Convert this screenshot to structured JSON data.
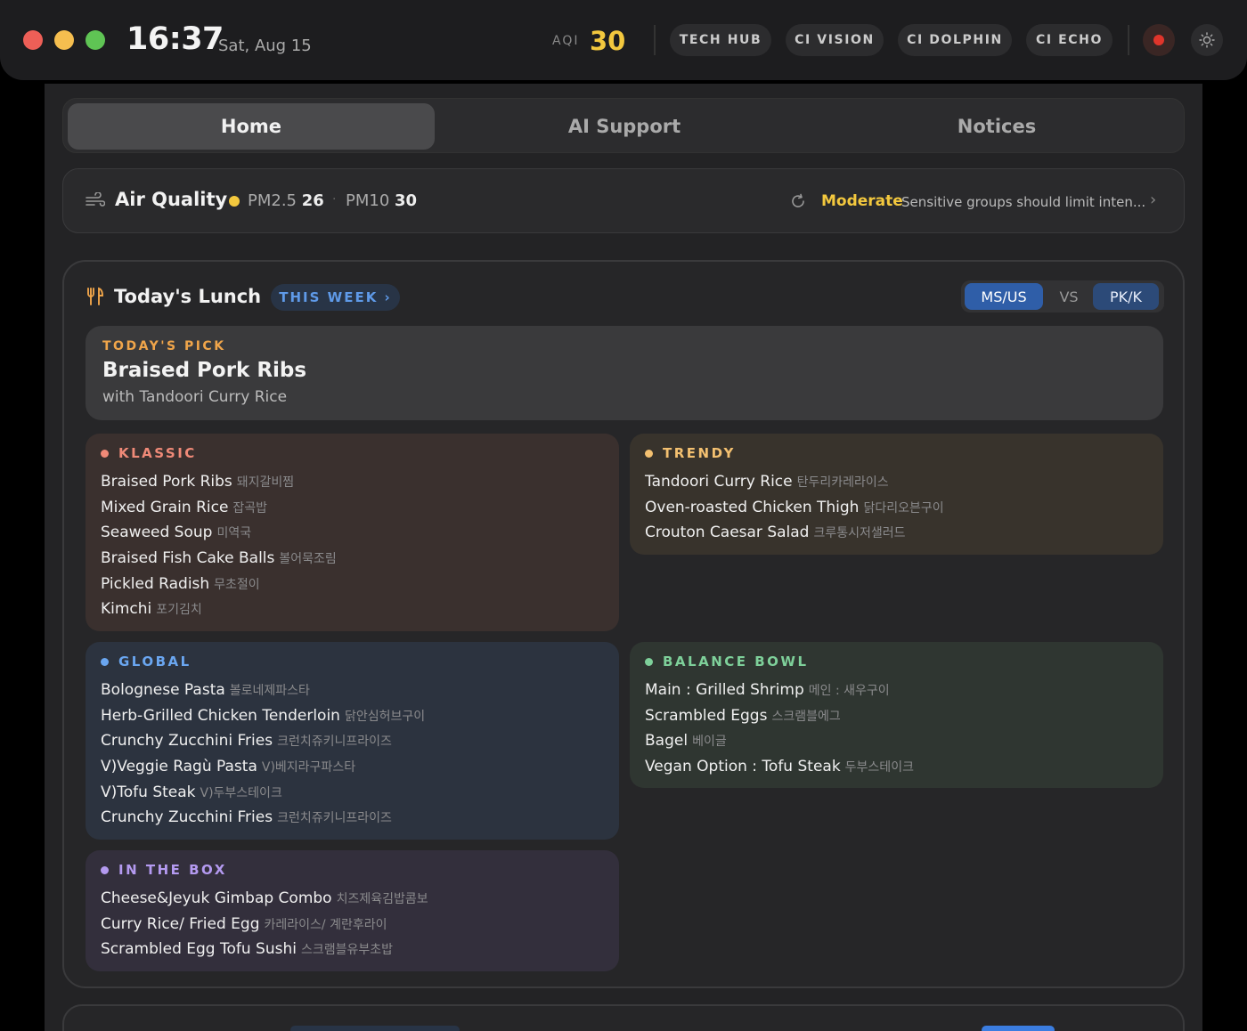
{
  "topbar": {
    "time": "16:37",
    "date": "Sat, Aug 15",
    "aqi_label": "AQI",
    "aqi_value": "30",
    "nav": [
      "TECH HUB",
      "CI VISION",
      "CI DOLPHIN",
      "CI ECHO"
    ]
  },
  "tabs": [
    "Home",
    "AI Support",
    "Notices"
  ],
  "air": {
    "title": "Air Quality",
    "pm25_label": "PM2.5",
    "pm25_value": "26",
    "pm10_label": "PM10",
    "pm10_value": "30",
    "status": "Moderate",
    "note": "Sensitive groups should limit inten..."
  },
  "lunch": {
    "title": "Today's Lunch",
    "week_label": "THIS WEEK",
    "toggle": {
      "left": "MS/US",
      "vs": "VS",
      "right": "PK/K"
    },
    "pick": {
      "label": "TODAY'S PICK",
      "name": "Braised Pork Ribs",
      "sub": "with Tandoori Curry Rice"
    },
    "klassic": {
      "title": "KLASSIC",
      "items": [
        {
          "en": "Braised Pork Ribs",
          "ko": "돼지갈비찜"
        },
        {
          "en": "Mixed Grain Rice",
          "ko": "잡곡밥"
        },
        {
          "en": "Seaweed Soup",
          "ko": "미역국"
        },
        {
          "en": "Braised Fish Cake Balls",
          "ko": "볼어묵조림"
        },
        {
          "en": "Pickled Radish",
          "ko": "무초절이"
        },
        {
          "en": "Kimchi",
          "ko": "포기김치"
        }
      ]
    },
    "trendy": {
      "title": "TRENDY",
      "items": [
        {
          "en": "Tandoori Curry Rice",
          "ko": "탄두리카레라이스"
        },
        {
          "en": "Oven-roasted Chicken Thigh",
          "ko": "닭다리오븐구이"
        },
        {
          "en": "Crouton Caesar Salad",
          "ko": "크루통시저샐러드"
        }
      ]
    },
    "global": {
      "title": "GLOBAL",
      "items": [
        {
          "en": "Bolognese Pasta",
          "ko": "볼로네제파스타"
        },
        {
          "en": "Herb-Grilled Chicken Tenderloin",
          "ko": "닭안심허브구이"
        },
        {
          "en": "Crunchy Zucchini Fries",
          "ko": "크런치쥬키니프라이즈"
        },
        {
          "en": "V)Veggie Ragù Pasta",
          "ko": "V)베지라구파스타"
        },
        {
          "en": "V)Tofu Steak",
          "ko": "V)두부스테이크"
        },
        {
          "en": "Crunchy Zucchini Fries",
          "ko": "크런치쥬키니프라이즈"
        }
      ]
    },
    "balance": {
      "title": "BALANCE BOWL",
      "items": [
        {
          "en": "Main : Grilled Shrimp",
          "ko": "메인 : 새우구이"
        },
        {
          "en": "Scrambled Eggs",
          "ko": "스크램블에그"
        },
        {
          "en": "Bagel",
          "ko": "베이글"
        },
        {
          "en": "Vegan Option : Tofu Steak",
          "ko": "두부스테이크"
        }
      ]
    },
    "box": {
      "title": "IN THE BOX",
      "items": [
        {
          "en": "Cheese&Jeyuk Gimbap Combo",
          "ko": "치즈제육김밥콤보"
        },
        {
          "en": "Curry Rice/ Fried Egg",
          "ko": "카레라이스/ 계란후라이"
        },
        {
          "en": "Scrambled Egg Tofu Sushi",
          "ko": "스크램블유부초밥"
        }
      ]
    }
  },
  "colors": {
    "accent_yellow": "#f3c83e",
    "pick_orange": "#f0a54a",
    "klassic": "#f08a78",
    "trendy": "#f3c070",
    "global": "#6aa6f0",
    "balance": "#7ed09a",
    "box": "#b49af0"
  }
}
